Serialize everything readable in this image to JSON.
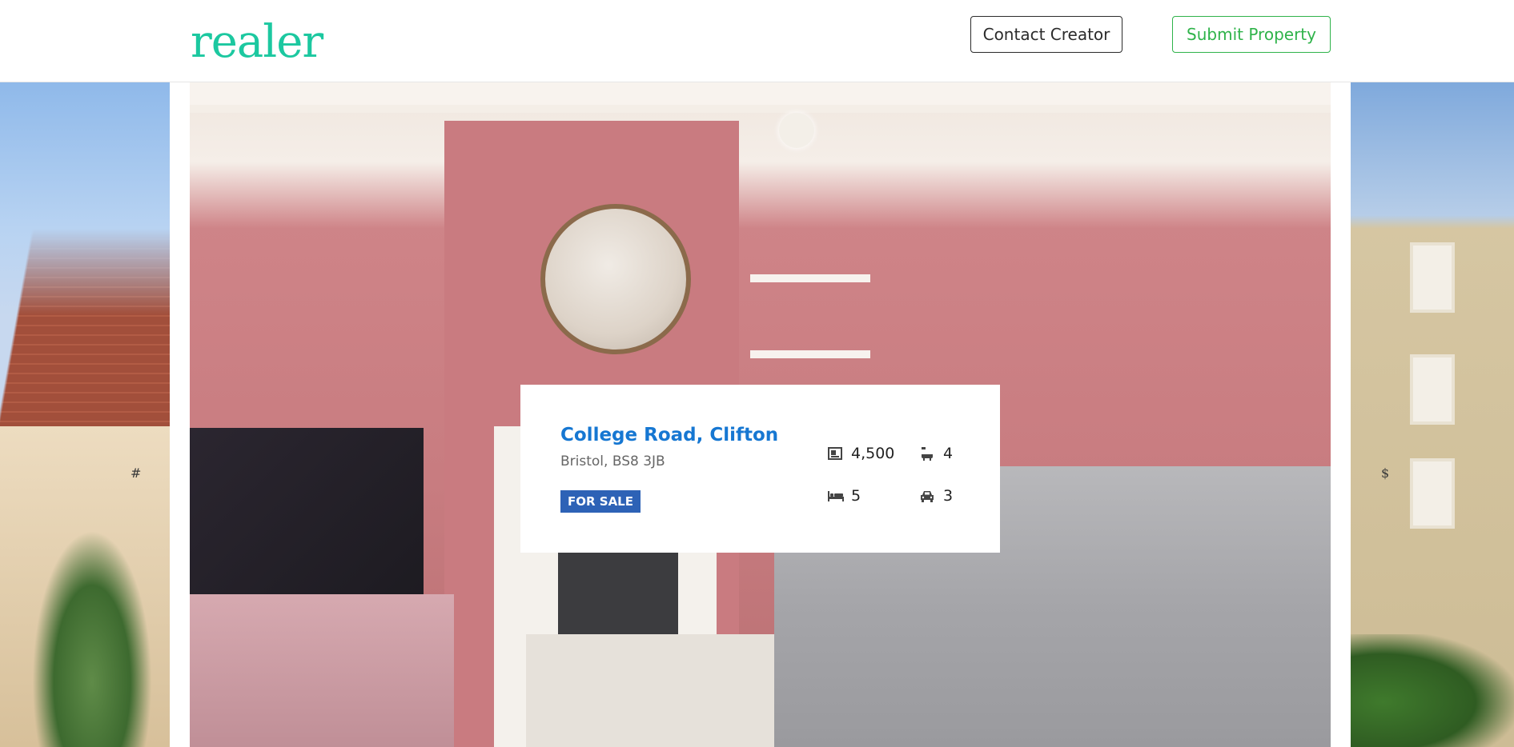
{
  "header": {
    "logo": "realer",
    "contact_label": "Contact Creator",
    "submit_label": "Submit Property"
  },
  "listing": {
    "title": "College Road, Clifton",
    "subtitle": "Bristol, BS8 3JB",
    "status": "FOR SALE",
    "stats": {
      "area": "4,500",
      "baths": "4",
      "beds": "5",
      "parking": "3"
    }
  },
  "side_marks": {
    "left": "#",
    "right": "$"
  },
  "icons": {
    "area": "area-icon",
    "bath": "bathtub-icon",
    "bed": "bed-icon",
    "car": "car-icon"
  },
  "colors": {
    "logo": "#1cc8a0",
    "submit": "#2fb34a",
    "title": "#1677d2",
    "badge": "#2d62b6"
  }
}
